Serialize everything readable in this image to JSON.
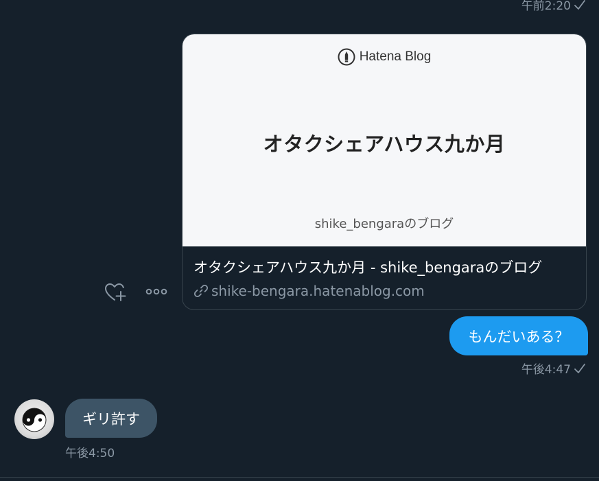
{
  "conversation": {
    "messages": [
      {
        "type": "timestamp",
        "time": "午前2:20",
        "read_receipt": "check-icon"
      },
      {
        "type": "link_card",
        "direction": "sent",
        "card": {
          "logo_text": "Hatena Blog",
          "logo_icon": "hatena-pen-icon",
          "headline": "オタクシェアハウス九か月",
          "blog_name": "shike_bengaraのブログ",
          "title": "オタクシェアハウス九か月 - shike_bengaraのブログ",
          "domain": "shike-bengara.hatenablog.com",
          "domain_icon": "link-icon"
        },
        "actions": [
          {
            "name": "react",
            "icon": "heart-plus-icon"
          },
          {
            "name": "more",
            "icon": "more-icon"
          }
        ]
      },
      {
        "type": "text",
        "direction": "sent",
        "text": "もんだいある？",
        "time": "午後4:47",
        "read_receipt": "check-icon"
      },
      {
        "type": "text",
        "direction": "received",
        "avatar_icon": "yin-yang-avatar",
        "text": "ギリ許す",
        "time": "午後4:50"
      }
    ]
  },
  "colors": {
    "background": "#15202b",
    "sent_bubble": "#1d9bf0",
    "received_bubble": "#3d5466",
    "secondary_text": "#8b98a5",
    "border": "#38444d",
    "card_image_bg": "#f6f7f9"
  }
}
